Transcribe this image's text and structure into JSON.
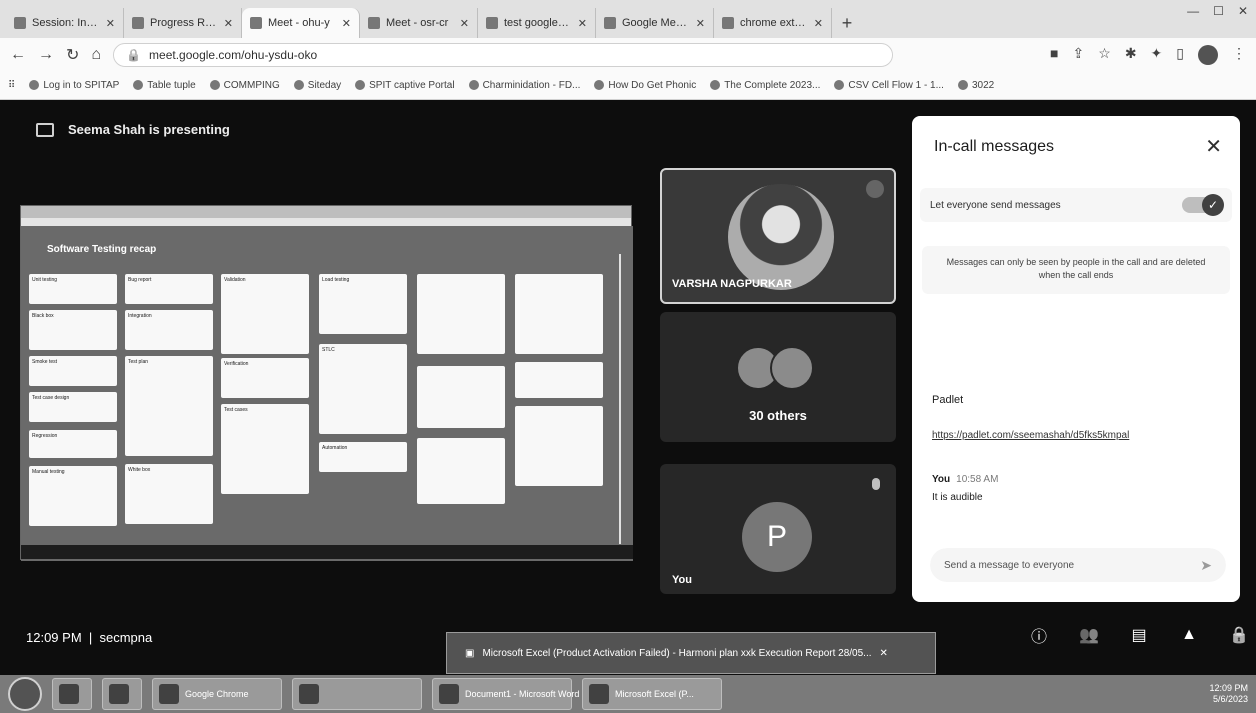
{
  "browser": {
    "tabs": [
      {
        "title": "Session: Introduc",
        "active": false
      },
      {
        "title": "Progress Repo",
        "active": false
      },
      {
        "title": "Meet - ohu-y",
        "active": true
      },
      {
        "title": "Meet - osr-cr",
        "active": false
      },
      {
        "title": "test google meet",
        "active": false
      },
      {
        "title": "Google Meet Atte",
        "active": false
      },
      {
        "title": "chrome extensio",
        "active": false
      }
    ],
    "url": "meet.google.com/ohu-ysdu-oko",
    "bookmarks": [
      "Log in to SPITAP",
      "Table tuple",
      "COMMPING",
      "Siteday",
      "SPIT captive Portal",
      "Charminidation - FD...",
      "How Do Get Phonic",
      "The Complete 2023...",
      "CSV Cell Flow 1 - 1...",
      "3022"
    ]
  },
  "meet": {
    "presenting": "Seema Shah is presenting",
    "shared_screen": {
      "board_title": "Software Testing recap",
      "cards": [
        "Unit testing",
        "Black box",
        "Smoke test",
        "Test case design",
        "Regression",
        "Manual testing",
        "Bug report",
        "Integration",
        "Test plan",
        "White box",
        "Validation",
        "Verification",
        "Test cases",
        "Load testing",
        "STLC",
        "Automation"
      ]
    },
    "tiles": [
      {
        "name": "VARSHA NAGPURKAR"
      },
      {
        "name": "30 others"
      },
      {
        "initial": "P",
        "name": "You"
      }
    ],
    "clock": "12:09 PM",
    "meeting_code": "secmpna",
    "notification": "Microsoft Excel (Product Activation Failed) - Harmoni plan xxk Execution Report 28/05..."
  },
  "panel": {
    "title": "In-call messages",
    "toggle_label": "Let everyone send messages",
    "note": "Messages can only be seen by people in the call and are deleted when the call ends",
    "messages": [
      {
        "text": "Padlet"
      },
      {
        "text": "https://padlet.com/sseemashah/d5fks5kmpal"
      }
    ],
    "you_label": "You",
    "you_time": "10:58 AM",
    "you_message": "It is audible",
    "input_placeholder": "Send a message to everyone"
  },
  "taskbar": {
    "items": [
      "",
      "",
      "",
      "",
      "Google Chrome",
      "Document1 - Microsoft Word",
      "Microsoft Excel (P..."
    ],
    "time": "12:09 PM",
    "date": "5/6/2023"
  }
}
